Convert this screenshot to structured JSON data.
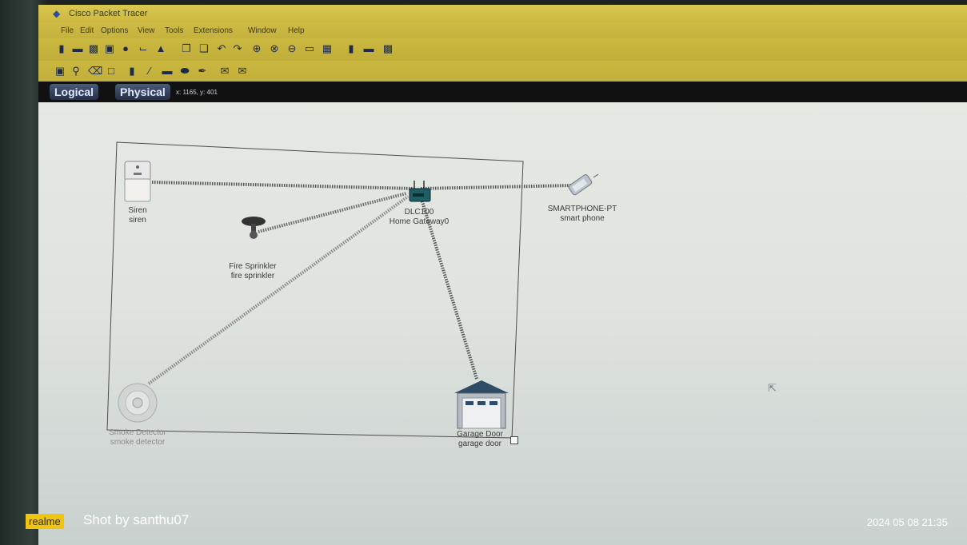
{
  "window": {
    "title": "Cisco Packet Tracer",
    "icon": "packet-tracer-icon"
  },
  "menu": [
    "File",
    "Edit",
    "Options",
    "View",
    "Tools",
    "Extensions",
    "Window",
    "Help"
  ],
  "tabs": {
    "logical": "Logical",
    "physical": "Physical",
    "coords": "x: 1165, y: 401"
  },
  "devices": {
    "siren": {
      "type": "Siren",
      "name": "siren"
    },
    "sprinkler": {
      "type": "Fire Sprinkler",
      "name": "fire sprinkler"
    },
    "gateway": {
      "type": "DLC100",
      "name": "Home Gateway0"
    },
    "phone": {
      "type": "SMARTPHONE-PT",
      "name": "smart phone"
    },
    "smoke": {
      "type": "Smoke Detector",
      "name": "smoke detector"
    },
    "garage": {
      "type": "Garage Door",
      "name": "garage door"
    }
  },
  "watermark": {
    "brand": "realme",
    "shot_by": "Shot by santhu07",
    "datetime": "2024 05 08 21:35"
  },
  "colors": {
    "titlebar": "#cdb840",
    "tabbar": "#111111",
    "link": "#5a5a5a",
    "watermark_brand": "#f1c40f"
  }
}
